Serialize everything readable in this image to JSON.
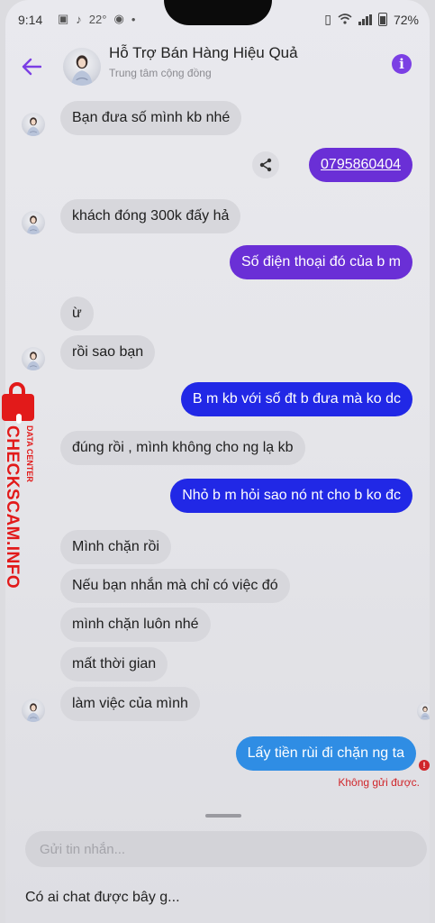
{
  "status_bar": {
    "time": "9:14",
    "temperature": "22°",
    "battery": "72%"
  },
  "header": {
    "title": "Hỗ Trợ Bán Hàng Hiệu Quả",
    "subtitle": "Trung tâm cộng đồng"
  },
  "messages": [
    {
      "side": "in",
      "text": "Bạn đưa số mình kb nhé"
    },
    {
      "side": "out",
      "text": "0795860404"
    },
    {
      "side": "in",
      "text": "khách đóng 300k đấy hả"
    },
    {
      "side": "out",
      "text": "Số điện thoại đó của b m"
    },
    {
      "side": "in",
      "text": "ừ"
    },
    {
      "side": "in",
      "text": "rồi sao bạn"
    },
    {
      "side": "out",
      "text": "B m kb với số đt b đưa mà ko dc"
    },
    {
      "side": "in",
      "text": "đúng rồi , mình không cho ng lạ kb"
    },
    {
      "side": "out",
      "text": "Nhỏ b m hỏi sao nó nt cho b ko đc"
    },
    {
      "side": "in",
      "text": "Mình chặn rồi"
    },
    {
      "side": "in",
      "text": "Nếu bạn nhắn mà chỉ có việc đó"
    },
    {
      "side": "in",
      "text": "mình chặn luôn nhé"
    },
    {
      "side": "in",
      "text": "mất thời gian"
    },
    {
      "side": "in",
      "text": "làm việc của mình"
    },
    {
      "side": "out",
      "text": "Lấy tiền rùi đi chặn ng ta"
    }
  ],
  "failed_notice": "Không gửi được.",
  "composer": {
    "placeholder": "Gửi tin nhắn..."
  },
  "suggestion": "Có ai chat được bây g...",
  "watermark": {
    "brand": "CHECKSCAM.INFO",
    "tag": "DATA CENTER"
  },
  "colors": {
    "accent": "#7b3fe4",
    "sent_purple": "#6a2fd6",
    "sent_blue": "#2128e6",
    "sent_failed": "#2f8de4",
    "error": "#d0262b",
    "watermark": "#e21a1a"
  }
}
